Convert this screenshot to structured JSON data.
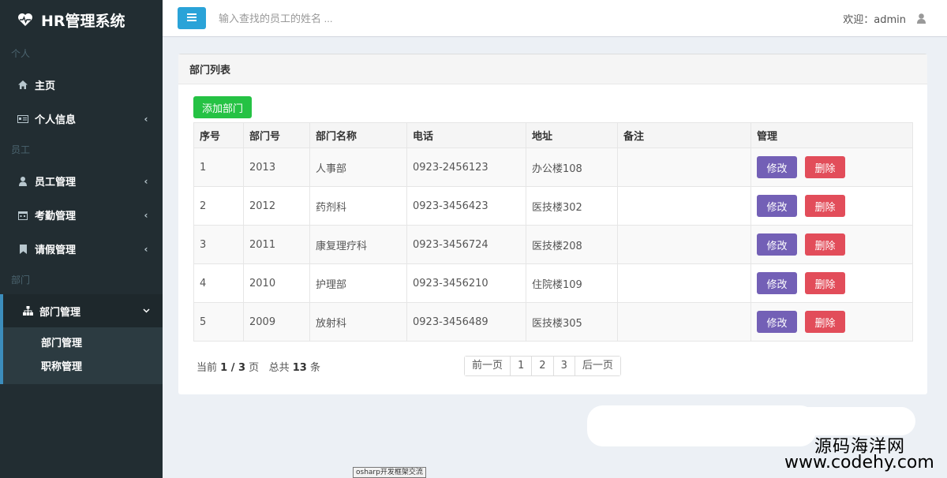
{
  "brand": {
    "title": "HR管理系统",
    "icon": "heartbeat-icon"
  },
  "sidebar": {
    "sections": [
      {
        "header": "个人",
        "items": [
          {
            "label": "主页",
            "icon": "home-icon"
          },
          {
            "label": "个人信息",
            "icon": "id-card-icon"
          }
        ]
      },
      {
        "header": "员工",
        "items": [
          {
            "label": "员工管理",
            "icon": "user-icon"
          },
          {
            "label": "考勤管理",
            "icon": "calendar-icon"
          },
          {
            "label": "请假管理",
            "icon": "bookmark-icon"
          }
        ]
      },
      {
        "header": "部门",
        "items": [
          {
            "label": "部门管理",
            "icon": "sitemap-icon"
          }
        ]
      }
    ],
    "submenu": [
      "部门管理",
      "职称管理"
    ]
  },
  "header": {
    "search_placeholder": "输入查找的员工的姓名 ...",
    "welcome": "欢迎：admin"
  },
  "box": {
    "title": "部门列表",
    "add_button": "添加部门",
    "columns": [
      "序号",
      "部门号",
      "部门名称",
      "电话",
      "地址",
      "备注",
      "管理"
    ],
    "rows": [
      {
        "no": "1",
        "dept_no": "2013",
        "name": "人事部",
        "phone": "0923-2456123",
        "address": "办公楼108",
        "note": ""
      },
      {
        "no": "2",
        "dept_no": "2012",
        "name": "药剂科",
        "phone": "0923-3456423",
        "address": "医技楼302",
        "note": ""
      },
      {
        "no": "3",
        "dept_no": "2011",
        "name": "康复理疗科",
        "phone": "0923-3456724",
        "address": "医技楼208",
        "note": ""
      },
      {
        "no": "4",
        "dept_no": "2010",
        "name": "护理部",
        "phone": "0923-3456210",
        "address": "住院楼109",
        "note": ""
      },
      {
        "no": "5",
        "dept_no": "2009",
        "name": "放射科",
        "phone": "0923-3456489",
        "address": "医技楼305",
        "note": ""
      }
    ],
    "edit_label": "修改",
    "delete_label": "删除",
    "page_info": {
      "prefix": "当前 ",
      "current": "1",
      "sep": " / ",
      "total_pages": "3",
      "mid": " 页   总共 ",
      "total": "13",
      "suffix": " 条"
    },
    "pagination": [
      "前一页",
      "1",
      "2",
      "3",
      "后一页"
    ]
  },
  "watermark": {
    "cn": "源码海洋网",
    "url": "www.codehy.com"
  },
  "footer_tag": "osharp开发框架交流",
  "colors": {
    "sidebar_bg": "#222d32",
    "accent": "#3c8dbc",
    "add_green": "#25c244",
    "edit_purple": "#7360b6",
    "delete_red": "#e24d5a"
  }
}
